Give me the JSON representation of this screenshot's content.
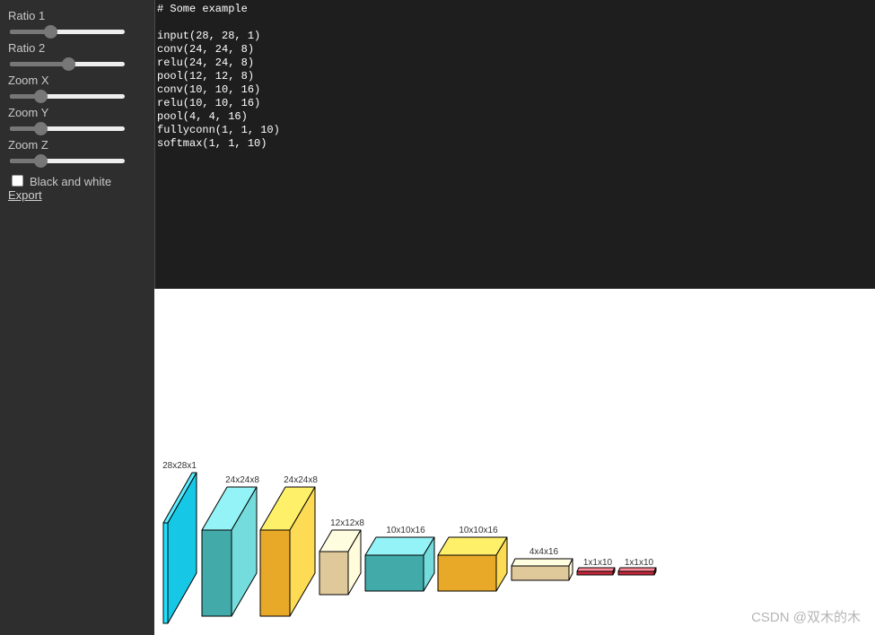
{
  "sidebar": {
    "controls": [
      {
        "label": "Ratio 1",
        "value": 0.33
      },
      {
        "label": "Ratio 2",
        "value": 0.51
      },
      {
        "label": "Zoom X",
        "value": 0.24
      },
      {
        "label": "Zoom Y",
        "value": 0.24
      },
      {
        "label": "Zoom Z",
        "value": 0.24
      }
    ],
    "black_and_white": {
      "label": "Black and white",
      "checked": false
    },
    "export_label": "Export"
  },
  "editor": {
    "text": "# Some example\n\ninput(28, 28, 1)\nconv(24, 24, 8)\nrelu(24, 24, 8)\npool(12, 12, 8)\nconv(10, 10, 16)\nrelu(10, 10, 16)\npool(4, 4, 16)\nfullyconn(1, 1, 10)\nsoftmax(1, 1, 10)"
  },
  "network": {
    "layers": [
      {
        "type": "input",
        "label": "28x28x1",
        "front": "#1ee3ff",
        "top": "#5cecff",
        "side": "#16c8e6"
      },
      {
        "type": "conv",
        "label": "24x24x8",
        "front": "#43aaaa",
        "top": "#93f3f6",
        "side": "#74dcdc"
      },
      {
        "type": "relu",
        "label": "24x24x8",
        "front": "#e8a928",
        "top": "#fff06a",
        "side": "#fedb55"
      },
      {
        "type": "pool",
        "label": "12x12x8",
        "front": "#dfc89a",
        "top": "#fffde0",
        "side": "#fffbdb"
      },
      {
        "type": "conv",
        "label": "10x10x16",
        "front": "#43aaaa",
        "top": "#93f3f6",
        "side": "#74dcdc"
      },
      {
        "type": "relu",
        "label": "10x10x16",
        "front": "#e8a928",
        "top": "#fff06a",
        "side": "#fedb55"
      },
      {
        "type": "pool",
        "label": "4x4x16",
        "front": "#dfc89a",
        "top": "#fffde0",
        "side": "#fffbdb"
      },
      {
        "type": "fullyconn",
        "label": "1x1x10",
        "front": "#c3283a",
        "top": "#ff8a98",
        "side": "#a01a2a"
      },
      {
        "type": "softmax",
        "label": "1x1x10",
        "front": "#c3283a",
        "top": "#ff8a98",
        "side": "#a01a2a"
      }
    ]
  },
  "watermark": "CSDN @双木的木"
}
